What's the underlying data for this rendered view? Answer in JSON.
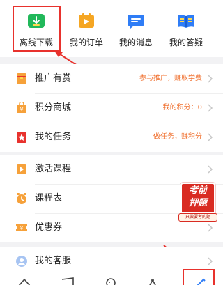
{
  "quick_actions": [
    {
      "label": "离线下载",
      "icon": "download-icon",
      "color": "#21b85a"
    },
    {
      "label": "我的订单",
      "icon": "order-icon",
      "color": "#f5a623"
    },
    {
      "label": "我的消息",
      "icon": "message-icon",
      "color": "#2f7df6"
    },
    {
      "label": "我的答疑",
      "icon": "qa-book-icon",
      "color": "#2f7df6"
    }
  ],
  "group1": [
    {
      "label": "推广有赏",
      "value": "参与推广，赚取学费",
      "value_color": "#f0702f",
      "icon": "red-envelope-icon"
    },
    {
      "label": "积分商城",
      "value": "我的积分：0",
      "value_color": "#f0702f",
      "icon": "points-mall-icon"
    },
    {
      "label": "我的任务",
      "value": "做任务，赚积分",
      "value_color": "#f0702f",
      "icon": "task-flag-icon"
    }
  ],
  "group2": [
    {
      "label": "激活课程",
      "icon": "activate-course-icon"
    },
    {
      "label": "课程表",
      "icon": "schedule-clock-icon"
    },
    {
      "label": "优惠券",
      "icon": "coupon-icon"
    }
  ],
  "group3": [
    {
      "label": "我的客服",
      "icon": "customer-service-icon"
    }
  ],
  "promo": {
    "line1": "考前",
    "line2": "押题",
    "sub": "只做要考的题"
  },
  "colors": {
    "accent_red": "#e8322d",
    "orange": "#f0702f",
    "icon_orange": "#f6a13a"
  }
}
